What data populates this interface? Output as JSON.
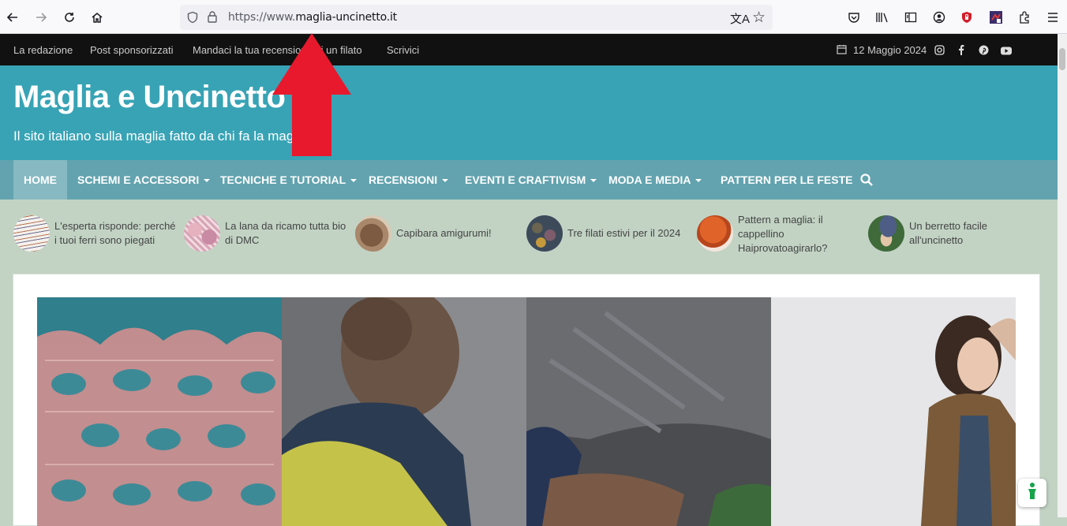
{
  "browser": {
    "url_prefix": "https://www.",
    "url_domain": "maglia-uncinetto.it",
    "nav_icons": [
      "back-icon",
      "forward-icon",
      "reload-icon",
      "home-icon"
    ],
    "toolbar_icons": [
      "translate-icon",
      "bookmark-star-icon",
      "pocket-icon",
      "library-icon",
      "reader-sidebar-icon",
      "account-icon",
      "ublock-icon",
      "extension-icon",
      "extensions-puzzle-icon",
      "menu-icon"
    ]
  },
  "topbar": {
    "links": [
      "La redazione",
      "Post sponsorizzati",
      "Mandaci la tua recensione di un filato",
      "Scrivici"
    ],
    "date": "12 Maggio 2024",
    "social": [
      "instagram-icon",
      "facebook-icon",
      "pinterest-icon",
      "youtube-icon"
    ]
  },
  "header": {
    "title": "Maglia e Uncinetto",
    "tagline": "Il sito italiano sulla maglia fatto da chi fa la maglia"
  },
  "menu": {
    "items": [
      {
        "label": "HOME",
        "dropdown": false
      },
      {
        "label": "SCHEMI E ACCESSORI",
        "dropdown": true
      },
      {
        "label": "TECNICHE E TUTORIAL",
        "dropdown": true
      },
      {
        "label": "RECENSIONI",
        "dropdown": true
      },
      {
        "label": "EVENTI E CRAFTIVISM",
        "dropdown": true
      },
      {
        "label": "MODA E MEDIA",
        "dropdown": true
      },
      {
        "label": "PATTERN PER LE FESTE",
        "dropdown": false
      }
    ]
  },
  "ticker": [
    {
      "line1": "L'esperta risponde: perché",
      "line2": "i tuoi ferri sono piegati",
      "line3": ""
    },
    {
      "line1": "La lana da ricamo tutta bio",
      "line2": "di DMC",
      "line3": ""
    },
    {
      "line1": "Capibara amigurumi!",
      "line2": "",
      "line3": ""
    },
    {
      "line1": "Tre filati estivi per il 2024",
      "line2": "",
      "line3": ""
    },
    {
      "line1": "Pattern a maglia: il",
      "line2": "cappellino",
      "line3": "Haiprovatoagirarlo?"
    },
    {
      "line1": "Un berretto facile",
      "line2": "all'uncinetto",
      "line3": ""
    }
  ],
  "colors": {
    "header": "#38a3b5",
    "menu": "#62a3af",
    "topbar": "#111111",
    "arrow": "#e8192c"
  }
}
